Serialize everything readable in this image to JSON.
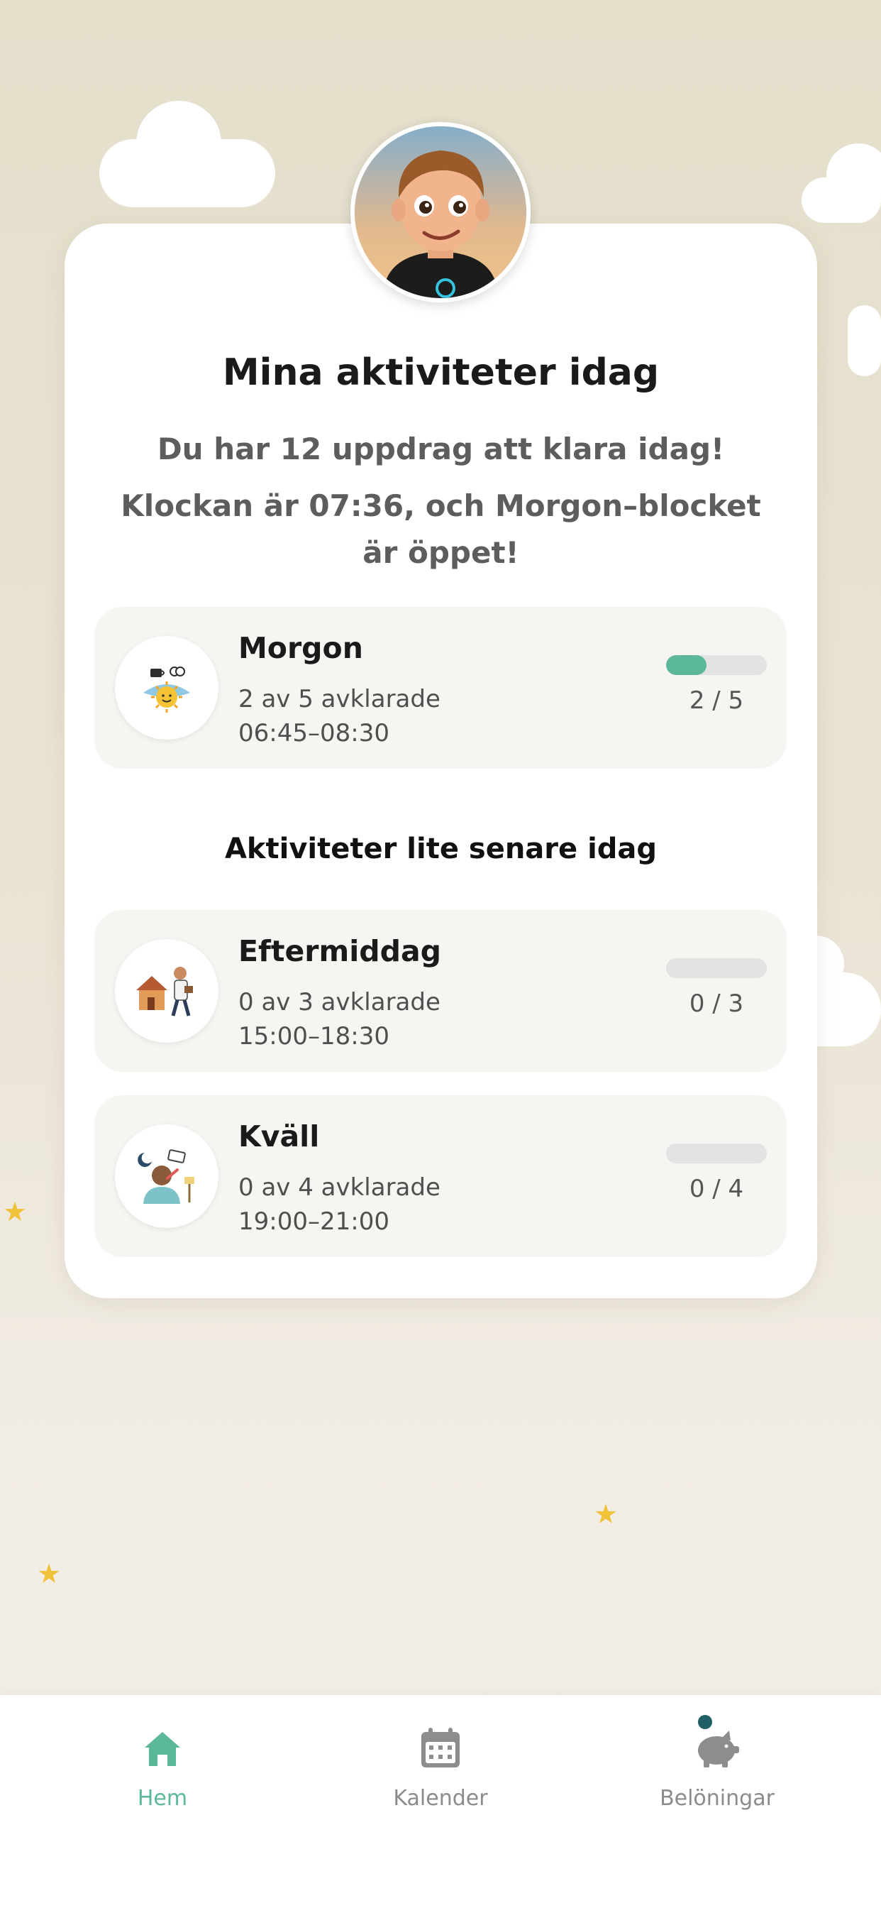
{
  "header": {
    "title": "Mina aktiviteter idag",
    "summary": "Du har 12 uppdrag att klara idag!",
    "status": "Klockan är 07:36, och Morgon–blocket är öppet!"
  },
  "current_block": {
    "name": "Morgon",
    "done_text": "2 av 5 avklarade",
    "time": "06:45–08:30",
    "count": "2 / 5",
    "progress": 0.4,
    "icon": "morning-sun-icon"
  },
  "later": {
    "title": "Aktiviteter lite senare idag",
    "blocks": [
      {
        "name": "Eftermiddag",
        "done_text": "0 av 3 avklarade",
        "time": "15:00–18:30",
        "count": "0 / 3",
        "progress": 0,
        "icon": "afternoon-walk-icon"
      },
      {
        "name": "Kväll",
        "done_text": "0 av 4 avklarade",
        "time": "19:00–21:00",
        "count": "0 / 4",
        "progress": 0,
        "icon": "evening-toothbrush-icon"
      }
    ]
  },
  "tabs": [
    {
      "label": "Hem",
      "icon": "home-icon",
      "active": true
    },
    {
      "label": "Kalender",
      "icon": "calendar-icon",
      "active": false
    },
    {
      "label": "Belöningar",
      "icon": "piggy-bank-icon",
      "active": false
    }
  ],
  "colors": {
    "accent": "#5bb89a",
    "background": "#e4dfcb",
    "card": "#ffffff",
    "block": "#f7f5f1",
    "star": "#f0c23a",
    "notification_dot": "#1f5f66"
  }
}
